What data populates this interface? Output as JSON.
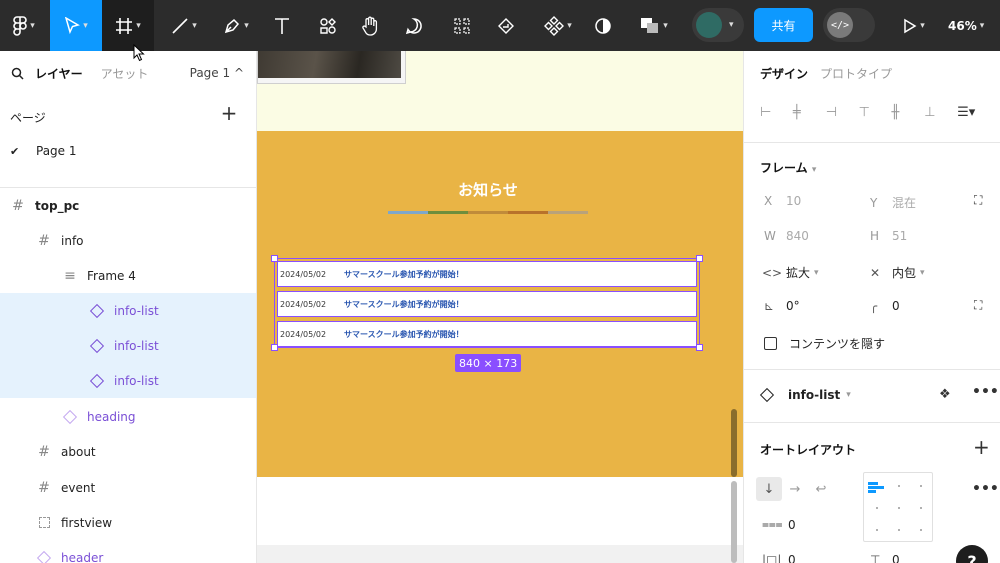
{
  "toolbar": {
    "zoom": "46%",
    "share_label": "共有",
    "dev_mode_label": "</>"
  },
  "left_panel": {
    "tabs": {
      "layers": "レイヤー",
      "assets": "アセット",
      "page_selector": "Page 1 ^"
    },
    "pages_title": "ページ",
    "add_page": "+",
    "pages": [
      {
        "name": "Page 1",
        "selected": true
      }
    ],
    "layers": [
      {
        "name": "top_pc",
        "type": "frame"
      },
      {
        "name": "info",
        "type": "frame"
      },
      {
        "name": "Frame 4",
        "type": "auto-layout"
      },
      {
        "name": "info-list",
        "type": "instance"
      },
      {
        "name": "info-list",
        "type": "instance"
      },
      {
        "name": "info-list",
        "type": "instance"
      },
      {
        "name": "heading",
        "type": "instance"
      },
      {
        "name": "about",
        "type": "frame"
      },
      {
        "name": "event",
        "type": "frame"
      },
      {
        "name": "firstview",
        "type": "section"
      },
      {
        "name": "header",
        "type": "instance"
      }
    ]
  },
  "canvas": {
    "section_heading": "お知らせ",
    "heading_bar_colors": [
      "#7fa7c9",
      "#6e8e3c",
      "#c08b3a",
      "#b8722b",
      "#b9a27a"
    ],
    "info_rows": [
      {
        "date": "2024/05/02",
        "title": "サマースクール参加予約が開始！"
      },
      {
        "date": "2024/05/02",
        "title": "サマースクール参加予約が開始！"
      },
      {
        "date": "2024/05/02",
        "title": "サマースクール参加予約が開始！"
      }
    ],
    "selection_size": "840 × 173"
  },
  "right_panel": {
    "tabs": {
      "design": "デザイン",
      "prototype": "プロトタイプ"
    },
    "frame_title": "フレーム",
    "x_label": "X",
    "x_value": "10",
    "y_label": "Y",
    "y_value": "混在",
    "w_label": "W",
    "w_value": "840",
    "h_label": "H",
    "h_value": "51",
    "resize_h": "拡大",
    "resize_v": "内包",
    "rotation": "0°",
    "radius": "0",
    "clip_content": "コンテンツを隠す",
    "component_name": "info-list",
    "autolayout_title": "オートレイアウト",
    "gap_value": "0",
    "padding_h": "0",
    "padding_v": "0",
    "help": "?"
  },
  "colors": {
    "accent": "#0d99ff",
    "selection": "#8a4fff",
    "section_bg": "#e9b445"
  }
}
